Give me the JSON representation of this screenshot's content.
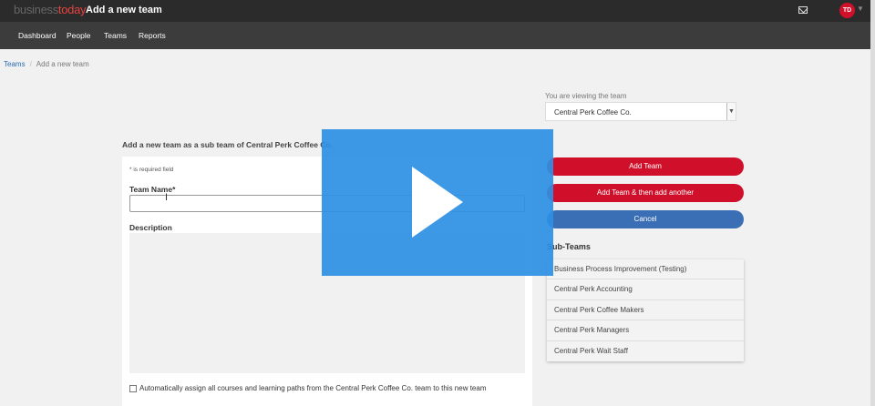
{
  "header": {
    "logo_prefix": "business",
    "logo_suffix": "today",
    "title": "Add a new team",
    "user_initials": "TD"
  },
  "nav": {
    "items": [
      "Dashboard",
      "People",
      "Teams",
      "Reports"
    ]
  },
  "breadcrumb": {
    "parent": "Teams",
    "separator": "/",
    "current": "Add a new team"
  },
  "viewing": {
    "label": "You are viewing the team",
    "selected_team": "Central Perk Coffee Co."
  },
  "form": {
    "heading": "Add a new team as a sub team of Central Perk Coffee Co.",
    "required_note": "* is required field",
    "team_name_label": "Team Name*",
    "team_name_value": "",
    "description_label": "Description",
    "description_value": "",
    "auto_assign_label": "Automatically assign all courses and learning paths from the Central Perk Coffee Co. team to this new team",
    "auto_assign_checked": false
  },
  "actions": {
    "add_team": "Add Team",
    "add_team_then_another": "Add Team & then add another",
    "cancel": "Cancel"
  },
  "subteams": {
    "heading": "Sub-Teams",
    "items": [
      "Business Process Improvement (Testing)",
      "Central Perk Accounting",
      "Central Perk Coffee Makers",
      "Central Perk Managers",
      "Central Perk Wait Staff"
    ]
  },
  "colors": {
    "accent_red": "#d0102a",
    "accent_blue": "#3a6fb6",
    "link": "#2a6db2",
    "video_overlay": "#2c8fe4"
  },
  "icons": {
    "mail": "mail-icon",
    "play": "play-icon",
    "cursor": "text-cursor-icon",
    "caret": "chevron-down-icon"
  }
}
